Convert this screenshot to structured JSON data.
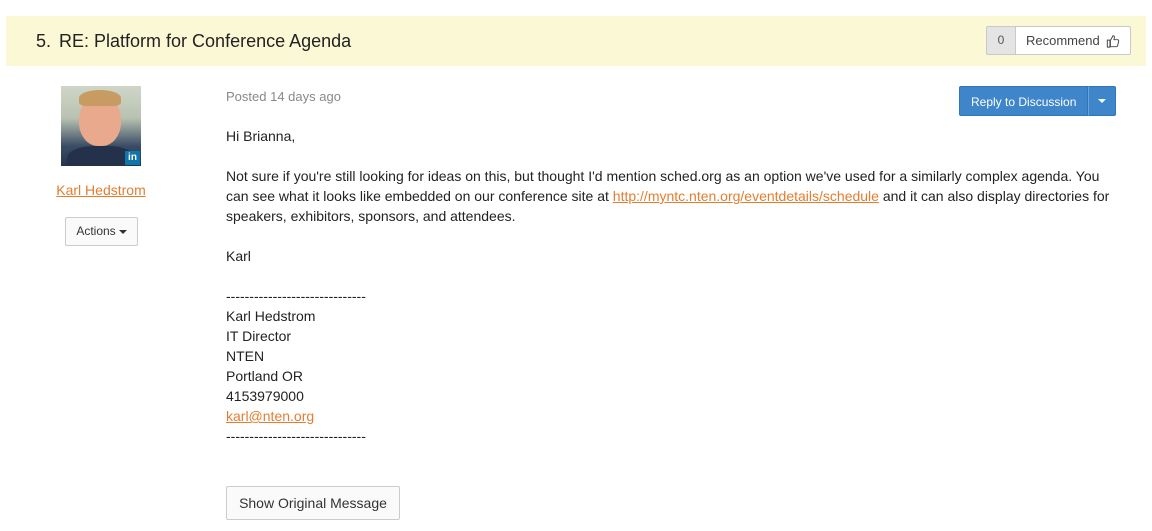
{
  "header": {
    "number": "5.",
    "title": "RE: Platform for Conference Agenda",
    "recommend_count": "0",
    "recommend_label": "Recommend"
  },
  "author": {
    "name": "Karl Hedstrom",
    "linkedin_badge": "in",
    "actions_label": "Actions"
  },
  "post": {
    "posted": "Posted 14 days ago",
    "reply_label": "Reply to Discussion",
    "greeting": "Hi Brianna,",
    "body_part1": "Not sure if you're still looking for ideas on this, but thought I'd mention sched.org as an option we've used for a similarly complex agenda. You can see what it looks like embedded on our conference site at ",
    "body_link": "http://myntc.nten.org/eventdetails/schedule",
    "body_part2": " and it can also display directories for speakers, exhibitors, sponsors, and attendees.",
    "signoff": "Karl",
    "signature": {
      "divider_top": "------------------------------",
      "name": "Karl Hedstrom",
      "title": "IT Director",
      "org": "NTEN",
      "location": "Portland OR",
      "phone": "4153979000",
      "email": "karl@nten.org",
      "divider_bottom": "------------------------------"
    },
    "show_original_label": "Show Original Message"
  },
  "colors": {
    "header_bg": "#fbf8d6",
    "accent_link": "#e57d2f",
    "primary_button": "#3e86c9"
  }
}
